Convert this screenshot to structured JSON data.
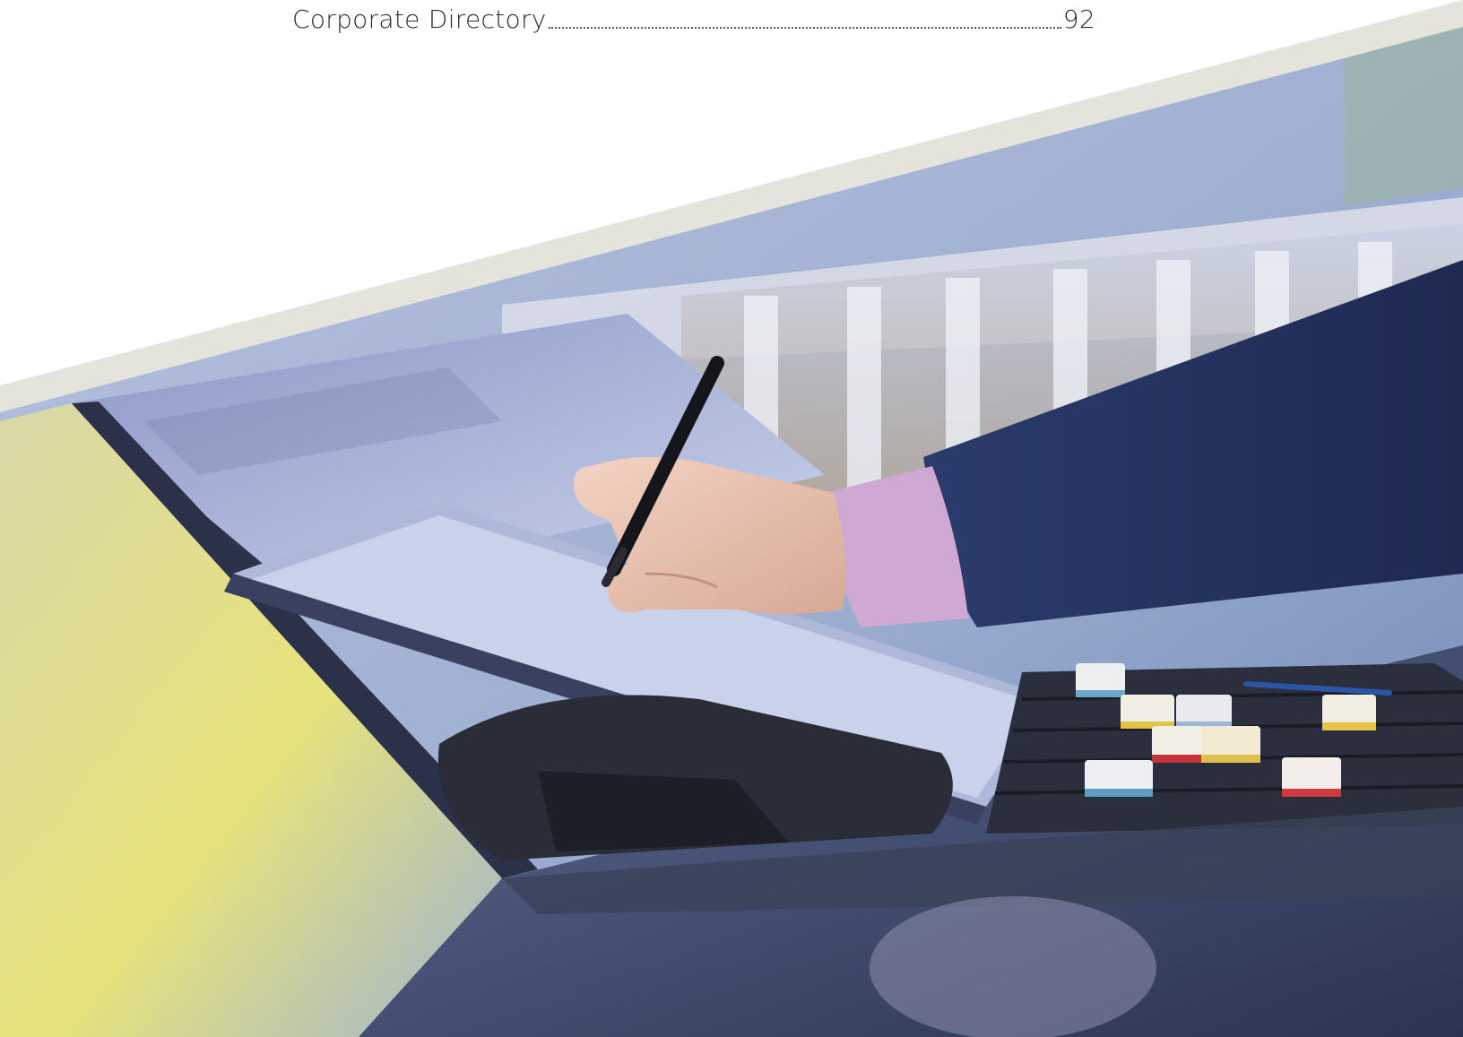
{
  "toc": {
    "entries": [
      {
        "label": "Corporate Directory",
        "page": "92"
      }
    ]
  },
  "colors": {
    "text": "#2c2c2c",
    "diagonal_band": "#e4e3dc",
    "suit": "#2a3a66",
    "cuff": "#cfa9d3",
    "background_wall": "#a9b7d4"
  },
  "image": {
    "subject": "hand-holding-stylus-over-tablet-at-control-desk"
  }
}
